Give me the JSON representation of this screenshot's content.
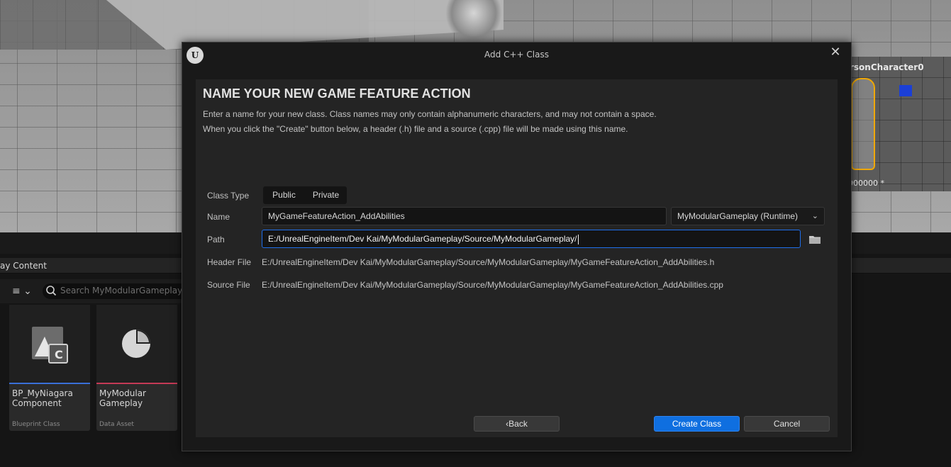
{
  "viewport": {
    "character_label": "rsonCharacter0",
    "number_label": "000000 *"
  },
  "content_browser": {
    "title": "ay Content",
    "search_placeholder": "Search MyModularGameplay",
    "assets": [
      {
        "name": "BP_MyNiagara Component",
        "type": "Blueprint Class",
        "strip_color": "#3a6fd8"
      },
      {
        "name": "MyModular Gameplay",
        "type": "Data Asset",
        "strip_color": "#c43a56"
      }
    ]
  },
  "dialog": {
    "title": "Add C++ Class",
    "heading": "NAME YOUR NEW GAME FEATURE ACTION",
    "description_line1": "Enter a name for your new class. Class names may only contain alphanumeric characters, and may not contain a space.",
    "description_line2": "When you click the \"Create\" button below, a header (.h) file and a source (.cpp) file will be made using this name.",
    "class_type": {
      "label": "Class Type",
      "options": [
        "Public",
        "Private"
      ]
    },
    "name": {
      "label": "Name",
      "value": "MyGameFeatureAction_AddAbilities",
      "module": "MyModularGameplay (Runtime)"
    },
    "path": {
      "label": "Path",
      "value": "E:/UnrealEngineItem/Dev Kai/MyModularGameplay/Source/MyModularGameplay/"
    },
    "header_file": {
      "label": "Header File",
      "value": "E:/UnrealEngineItem/Dev Kai/MyModularGameplay/Source/MyModularGameplay/MyGameFeatureAction_AddAbilities.h"
    },
    "source_file": {
      "label": "Source File",
      "value": "E:/UnrealEngineItem/Dev Kai/MyModularGameplay/Source/MyModularGameplay/MyGameFeatureAction_AddAbilities.cpp"
    },
    "buttons": {
      "back": "Back",
      "create": "Create Class",
      "cancel": "Cancel"
    }
  },
  "colors": {
    "accent": "#0f6fe0",
    "focus_border": "#1f6feb"
  }
}
